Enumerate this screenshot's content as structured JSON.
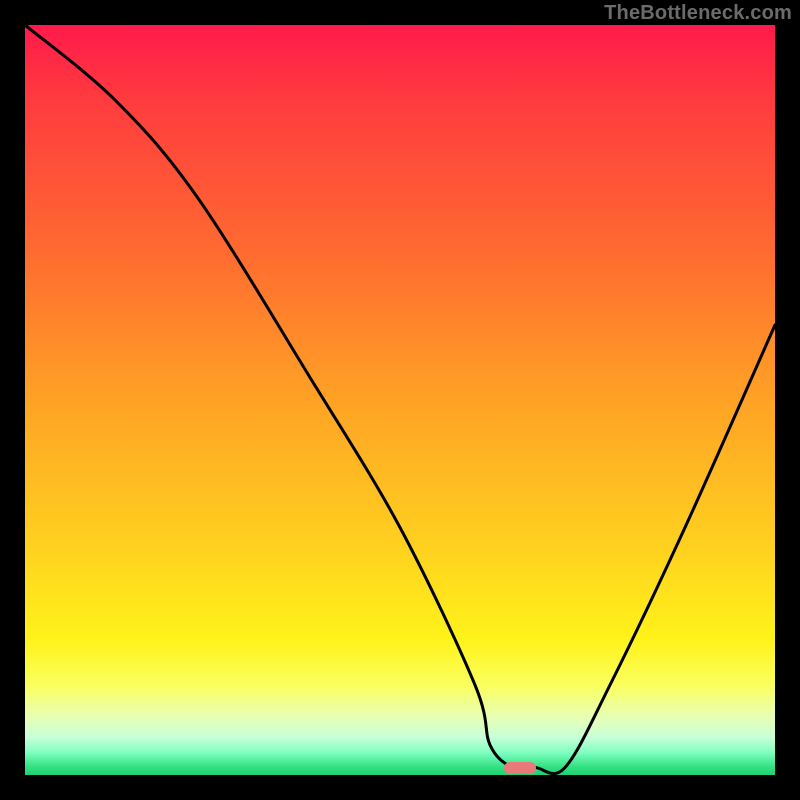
{
  "watermark": "TheBottleneck.com",
  "chart_data": {
    "type": "line",
    "title": "",
    "xlabel": "",
    "ylabel": "",
    "xlim": [
      0,
      100
    ],
    "ylim": [
      0,
      100
    ],
    "grid": false,
    "legend": false,
    "series": [
      {
        "name": "bottleneck-curve",
        "x": [
          0,
          12,
          23,
          38,
          50,
          60,
          62,
          65,
          68,
          72,
          78,
          88,
          100
        ],
        "y": [
          100,
          90,
          77,
          53,
          33,
          12,
          4,
          1,
          1,
          1,
          12,
          33,
          60
        ]
      }
    ],
    "marker": {
      "x": 66,
      "y": 1,
      "width_pct": 4.3,
      "height_pct": 1.6
    },
    "background_gradient": {
      "stops": [
        {
          "pos": 0.0,
          "color": "#ff1a4a"
        },
        {
          "pos": 0.1,
          "color": "#ff3b3f"
        },
        {
          "pos": 0.3,
          "color": "#ff6a30"
        },
        {
          "pos": 0.5,
          "color": "#ffa225"
        },
        {
          "pos": 0.7,
          "color": "#ffd21f"
        },
        {
          "pos": 0.82,
          "color": "#fff31a"
        },
        {
          "pos": 0.88,
          "color": "#fbff5e"
        },
        {
          "pos": 0.92,
          "color": "#e9ffb0"
        },
        {
          "pos": 0.95,
          "color": "#c8ffd8"
        },
        {
          "pos": 0.97,
          "color": "#7fffc0"
        },
        {
          "pos": 0.99,
          "color": "#30e080"
        },
        {
          "pos": 1.0,
          "color": "#1fd074"
        }
      ]
    }
  }
}
